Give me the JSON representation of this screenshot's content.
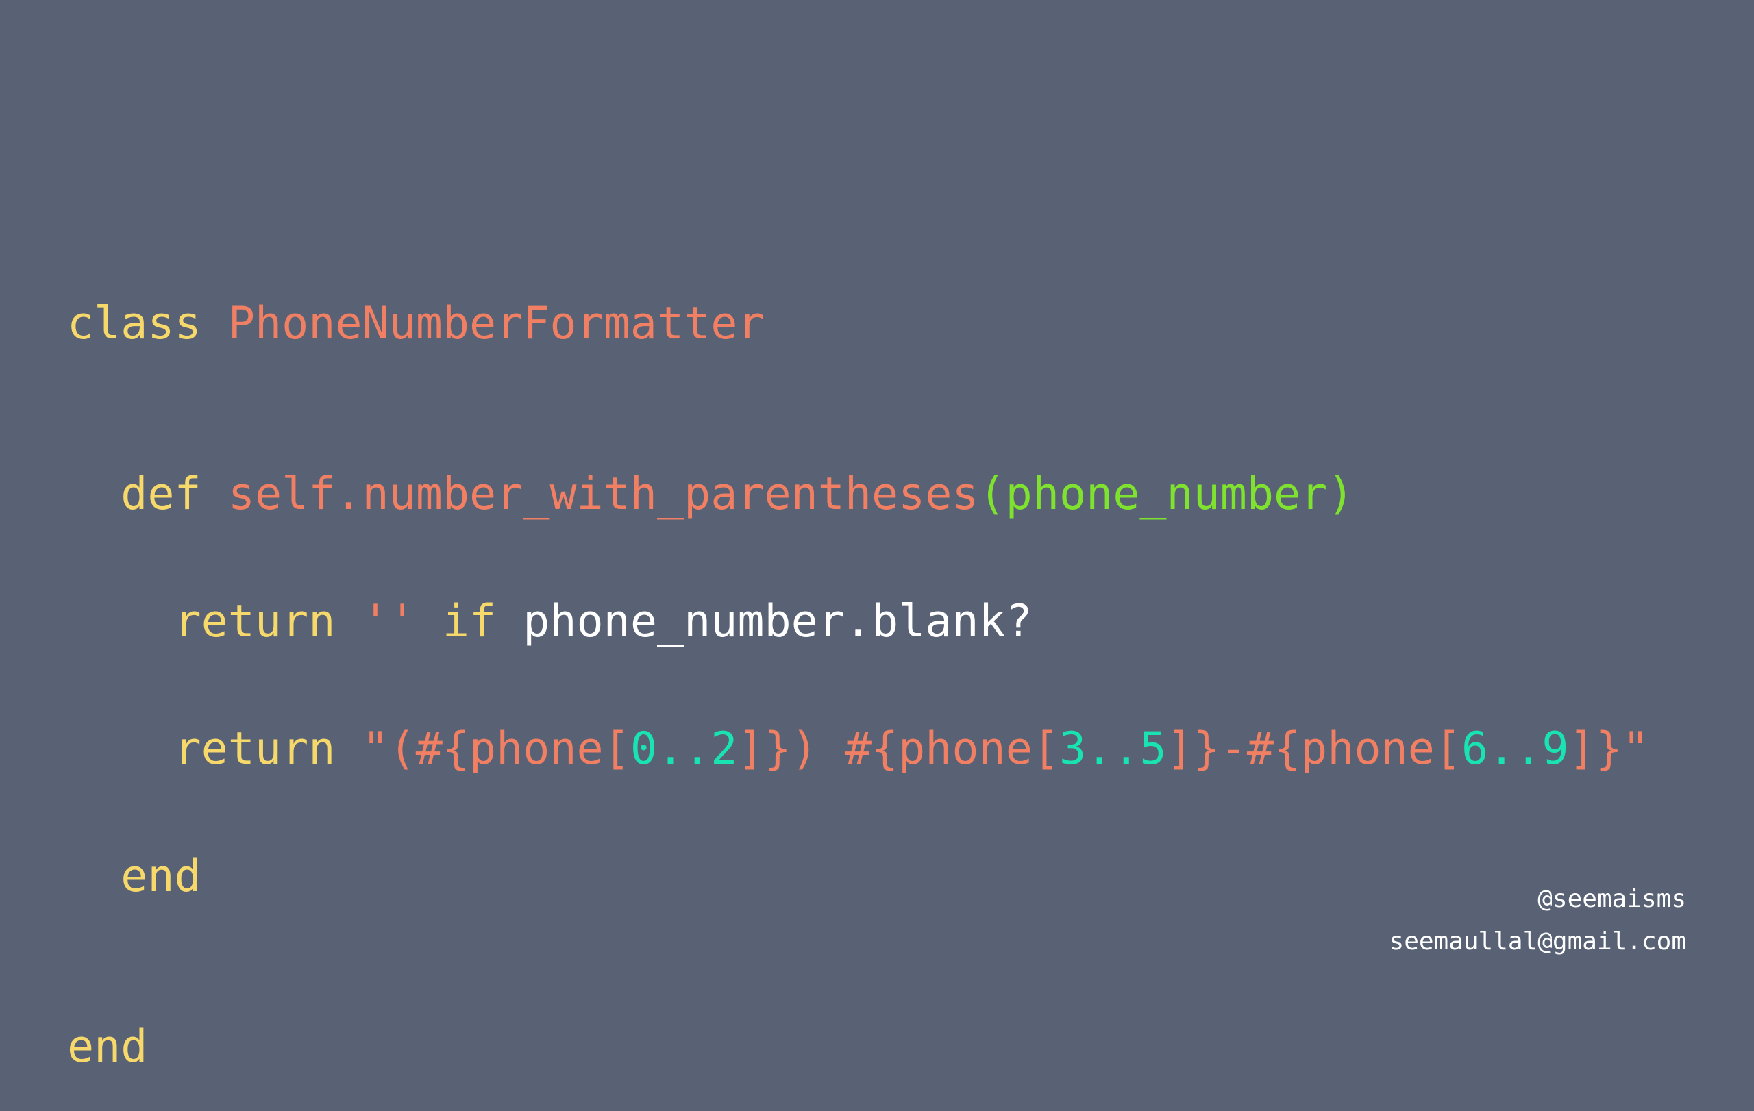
{
  "colors": {
    "background": "#586274",
    "keyword": "#F6D86B",
    "name": "#F07F63",
    "param": "#7EE22F",
    "plain": "#FFFFFF",
    "number": "#19E3B1",
    "footer": "#FFFFFF"
  },
  "code": {
    "lines": [
      {
        "tokens": [
          {
            "text": "class ",
            "kind": "keyword"
          },
          {
            "text": "PhoneNumberFormatter",
            "kind": "name"
          }
        ]
      },
      {
        "tokens": [
          {
            "text": "  def ",
            "kind": "keyword"
          },
          {
            "text": "self.number_with_parentheses",
            "kind": "name"
          },
          {
            "text": "(phone_number)",
            "kind": "param"
          }
        ]
      },
      {
        "tokens": [
          {
            "text": "    return ",
            "kind": "keyword"
          },
          {
            "text": "'' ",
            "kind": "name"
          },
          {
            "text": "if ",
            "kind": "keyword"
          },
          {
            "text": "phone_number.blank?",
            "kind": "plain"
          }
        ]
      },
      {
        "tokens": [
          {
            "text": "    return ",
            "kind": "keyword"
          },
          {
            "text": "\"(#{phone[",
            "kind": "name"
          },
          {
            "text": "0..2",
            "kind": "number"
          },
          {
            "text": "]}) #{phone[",
            "kind": "name"
          },
          {
            "text": "3..5",
            "kind": "number"
          },
          {
            "text": "]}-#{phone[",
            "kind": "name"
          },
          {
            "text": "6..9",
            "kind": "number"
          },
          {
            "text": "]}\"",
            "kind": "name"
          }
        ]
      },
      {
        "tokens": [
          {
            "text": "  end",
            "kind": "keyword"
          }
        ]
      },
      {
        "tokens": [
          {
            "text": "end",
            "kind": "keyword"
          }
        ]
      }
    ]
  },
  "footer": {
    "handle": "@seemaisms",
    "email": "seemaullal@gmail.com"
  }
}
